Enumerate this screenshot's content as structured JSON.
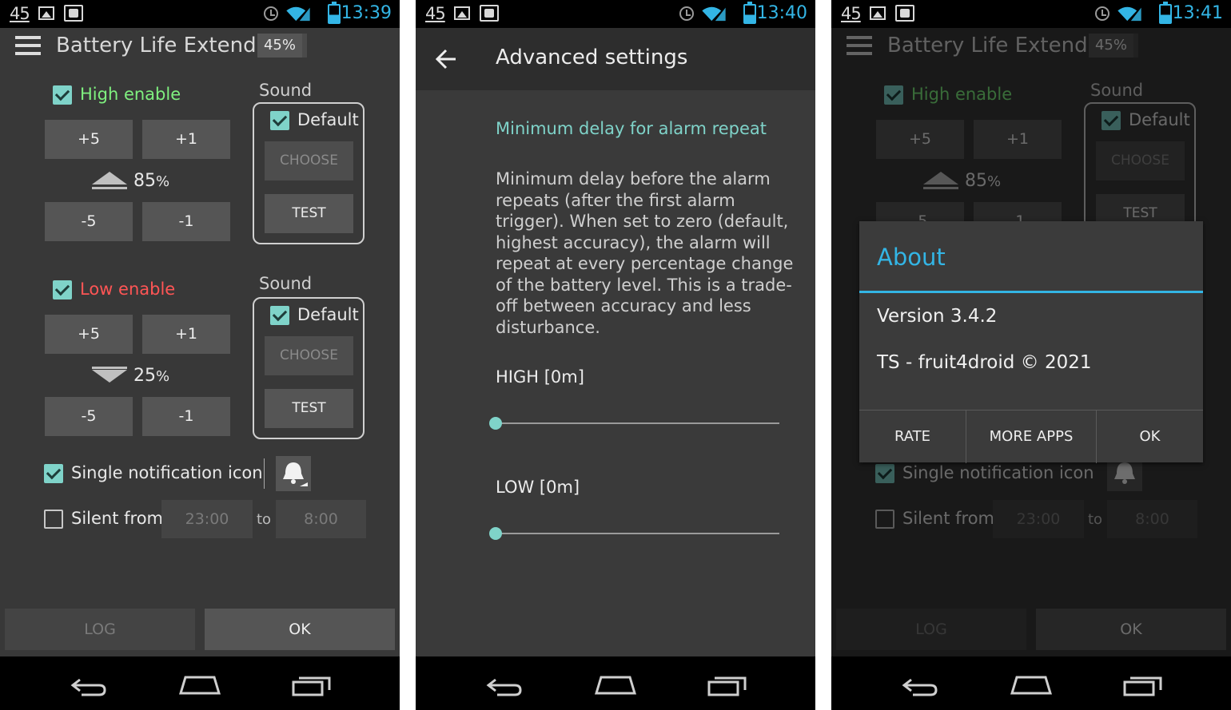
{
  "status": {
    "notif_count": "45",
    "time1": "13:39",
    "time2": "13:40",
    "time3": "13:41",
    "accent": "#33b5e5"
  },
  "main": {
    "title": "Battery Life Extender",
    "battery_badge": "45%",
    "high": {
      "label": "High enable",
      "color": "#7ff07f",
      "checked": true,
      "plus5": "+5",
      "plus1": "+1",
      "minus5": "-5",
      "minus1": "-1",
      "value": "85",
      "unit": "%",
      "sound_label": "Sound",
      "default_label": "Default",
      "choose": "CHOOSE",
      "test": "TEST"
    },
    "low": {
      "label": "Low enable",
      "color": "#ff5555",
      "checked": true,
      "plus5": "+5",
      "plus1": "+1",
      "minus5": "-5",
      "minus1": "-1",
      "value": "25",
      "unit": "%",
      "sound_label": "Sound",
      "default_label": "Default",
      "choose": "CHOOSE",
      "test": "TEST"
    },
    "single_notification": "Single notification icon",
    "silent_from": "Silent from",
    "silent_start": "23:00",
    "to": "to",
    "silent_end": "8:00",
    "log": "LOG",
    "ok": "OK"
  },
  "advanced": {
    "title": "Advanced settings",
    "pref_title": "Minimum delay for alarm repeat",
    "pref_desc": "Minimum delay before the alarm repeats (after the first alarm trigger). When set to zero (default, highest accuracy), the alarm will repeat at every percentage change of the battery level. This is a trade-off between accuracy and less disturbance.",
    "high_label": "HIGH  [0m]",
    "low_label": "LOW  [0m]",
    "high_value": 0,
    "low_value": 0
  },
  "about": {
    "title": "About",
    "version": "Version 3.4.2",
    "copyright": "TS - fruit4droid © 2021",
    "rate": "RATE",
    "more_apps": "MORE APPS",
    "ok": "OK"
  }
}
